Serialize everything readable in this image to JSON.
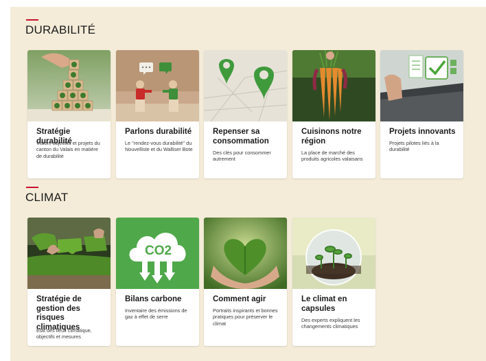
{
  "sections": [
    {
      "title": "DURABILITÉ",
      "cards": [
        {
          "title": "Stratégie durabilité",
          "desc": "Vision, objectifs et projets du canton du Valais en matière de durabilité",
          "image": "wooden-blocks-sustainability-icons"
        },
        {
          "title": "Parlons durabilité",
          "desc": "Le \"rendez-vous durabilité\" du Nouvelliste et du Walliser Bote",
          "image": "wooden-figures-speech-bubbles"
        },
        {
          "title": "Repenser sa consommation",
          "desc": "Des clés pour consommer autrement",
          "image": "green-map-pins"
        },
        {
          "title": "Cuisinons notre région",
          "desc": "La place de marché des produits agricoles valaisans",
          "image": "fresh-carrots-vegetables"
        },
        {
          "title": "Projets innovants",
          "desc": "Projets pilotes liés à la durabilité",
          "image": "laptop-checklist-checkmark"
        }
      ]
    },
    {
      "title": "CLIMAT",
      "cards": [
        {
          "title": "Stratégie de gestion des risques climatiques",
          "desc": "Etat des lieux climatique, objectifs et mesures",
          "image": "moss-puzzle-pieces"
        },
        {
          "title": "Bilans carbone",
          "desc": "Inventaire des émissions de gaz à effet de serre",
          "image": "co2-cloud-icon",
          "icon_text": "CO2"
        },
        {
          "title": "Comment agir",
          "desc": "Portraits inspirants et bonnes pratiques pour préserver le climat",
          "image": "hands-holding-heart-leaf"
        },
        {
          "title": "Le climat en capsules",
          "desc": "Des experts expliquent les changements climatiques",
          "image": "glass-sphere-seedling"
        }
      ]
    }
  ],
  "colors": {
    "background": "#f4ecd9",
    "accent": "#c8102e",
    "card": "#ffffff",
    "title_text": "#1a1a1a"
  }
}
